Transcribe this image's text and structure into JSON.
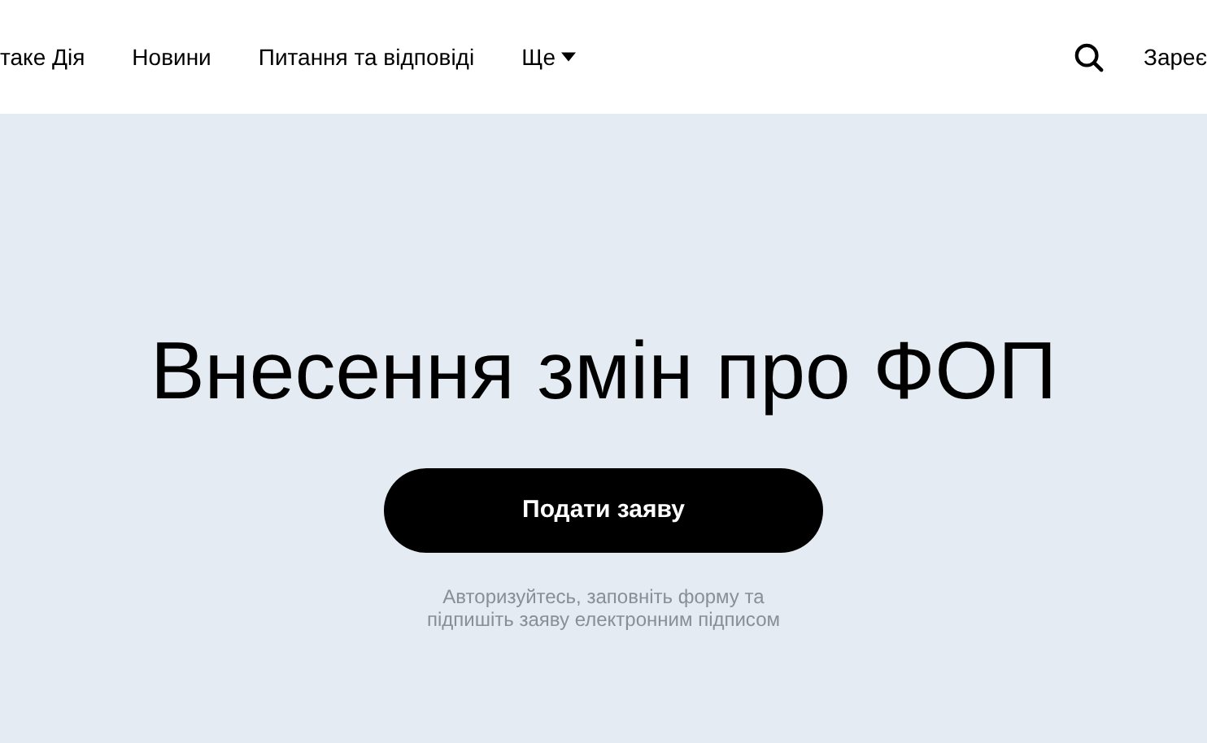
{
  "nav": {
    "items": [
      {
        "label": "таке Дія",
        "dropdown": false
      },
      {
        "label": "Новини",
        "dropdown": false
      },
      {
        "label": "Питання та відповіді",
        "dropdown": false
      },
      {
        "label": "Ще",
        "dropdown": true
      }
    ],
    "register_link": "Зареє"
  },
  "hero": {
    "title": "Внесення змін про ФОП",
    "button": "Подати заяву",
    "hint_lines": [
      "Авторизуйтесь, заповніть форму та",
      "підпишіть заяву електронним підписом"
    ]
  }
}
